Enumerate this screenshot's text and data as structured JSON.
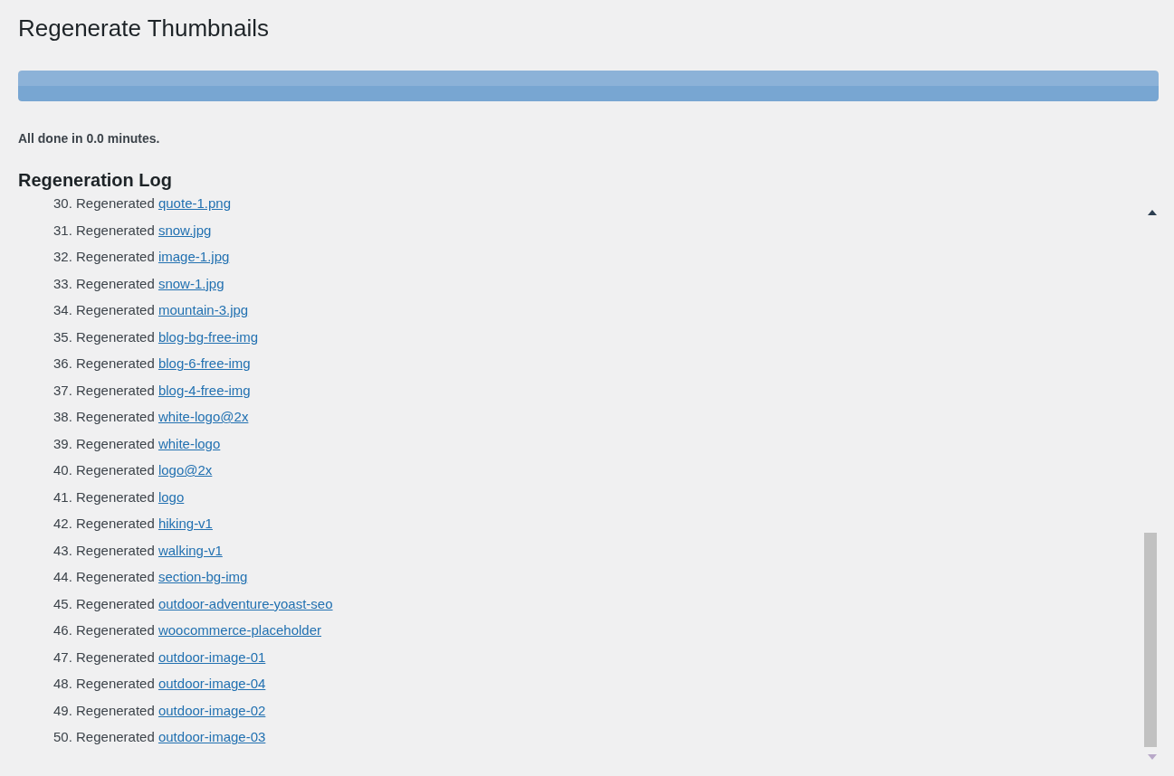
{
  "title": "Regenerate Thumbnails",
  "progress": {
    "level": 1
  },
  "status": "All done in 0.0 minutes.",
  "log": {
    "heading": "Regeneration Log",
    "entries": [
      {
        "number": "30.",
        "text": "Regenerated",
        "file": "quote-1.png"
      },
      {
        "number": "31.",
        "text": "Regenerated",
        "file": "snow.jpg"
      },
      {
        "number": "32.",
        "text": "Regenerated",
        "file": "image-1.jpg"
      },
      {
        "number": "33.",
        "text": "Regenerated",
        "file": "snow-1.jpg"
      },
      {
        "number": "34.",
        "text": "Regenerated",
        "file": "mountain-3.jpg"
      },
      {
        "number": "35.",
        "text": "Regenerated",
        "file": "blog-bg-free-img"
      },
      {
        "number": "36.",
        "text": "Regenerated",
        "file": "blog-6-free-img"
      },
      {
        "number": "37.",
        "text": "Regenerated",
        "file": "blog-4-free-img"
      },
      {
        "number": "38.",
        "text": "Regenerated",
        "file": "white-logo@2x"
      },
      {
        "number": "39.",
        "text": "Regenerated",
        "file": "white-logo"
      },
      {
        "number": "40.",
        "text": "Regenerated",
        "file": "logo@2x"
      },
      {
        "number": "41.",
        "text": "Regenerated",
        "file": "logo"
      },
      {
        "number": "42.",
        "text": "Regenerated",
        "file": "hiking-v1"
      },
      {
        "number": "43.",
        "text": "Regenerated",
        "file": "walking-v1"
      },
      {
        "number": "44.",
        "text": "Regenerated",
        "file": "section-bg-img"
      },
      {
        "number": "45.",
        "text": "Regenerated",
        "file": "outdoor-adventure-yoast-seo"
      },
      {
        "number": "46.",
        "text": "Regenerated",
        "file": "woocommerce-placeholder"
      },
      {
        "number": "47.",
        "text": "Regenerated",
        "file": "outdoor-image-01"
      },
      {
        "number": "48.",
        "text": "Regenerated",
        "file": "outdoor-image-04"
      },
      {
        "number": "49.",
        "text": "Regenerated",
        "file": "outdoor-image-02"
      },
      {
        "number": "50.",
        "text": "Regenerated",
        "file": "outdoor-image-03"
      }
    ]
  }
}
